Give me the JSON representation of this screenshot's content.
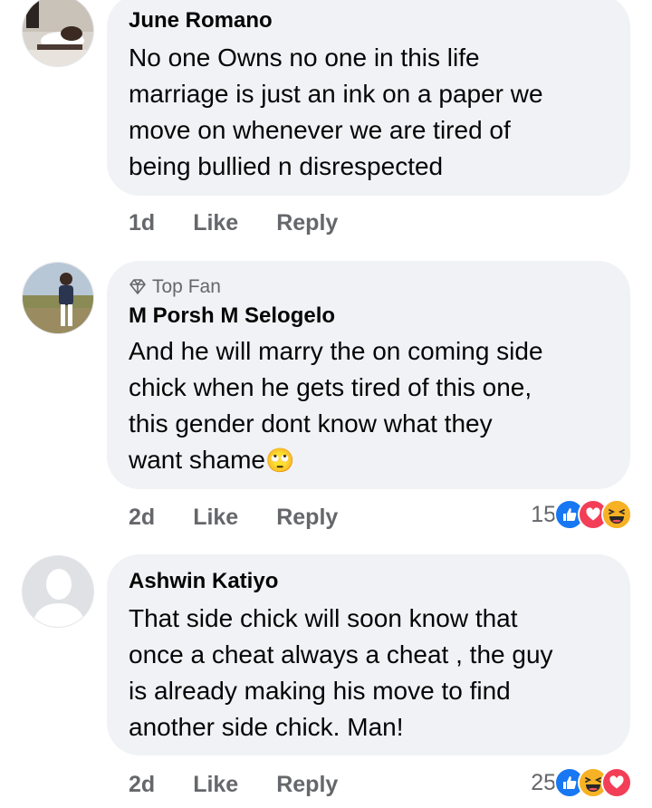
{
  "comments": [
    {
      "author": "June Romano",
      "text": "No one Owns no one in this life\nmarriage is just an ink on a paper we\nmove on whenever we are tired of\nbeing bullied n disrespected",
      "time": "1d",
      "like_label": "Like",
      "reply_label": "Reply"
    },
    {
      "badge": "Top Fan",
      "author": "M Porsh M Selogelo",
      "text": "And he will marry the on coming side\nchick when he gets tired of this one,\nthis gender dont know what they\nwant shame",
      "emoji": "🙄",
      "time": "2d",
      "like_label": "Like",
      "reply_label": "Reply",
      "reaction_count": "15",
      "reactions": [
        "like-icon",
        "love-icon",
        "haha-icon"
      ]
    },
    {
      "author": "Ashwin Katiyo",
      "text": "That side chick will soon know that\nonce a cheat always a cheat , the guy\nis already making his move to find\nanother side chick. Man!",
      "time": "2d",
      "like_label": "Like",
      "reply_label": "Reply",
      "reaction_count": "25",
      "reactions": [
        "like-icon",
        "haha-icon",
        "love-icon"
      ]
    }
  ],
  "colors": {
    "bubble": "#f0f2f5",
    "meta_text": "#65676b",
    "like_blue": "#1877f2",
    "love_red": "#f33e58",
    "haha_yellow": "#f7b125"
  }
}
